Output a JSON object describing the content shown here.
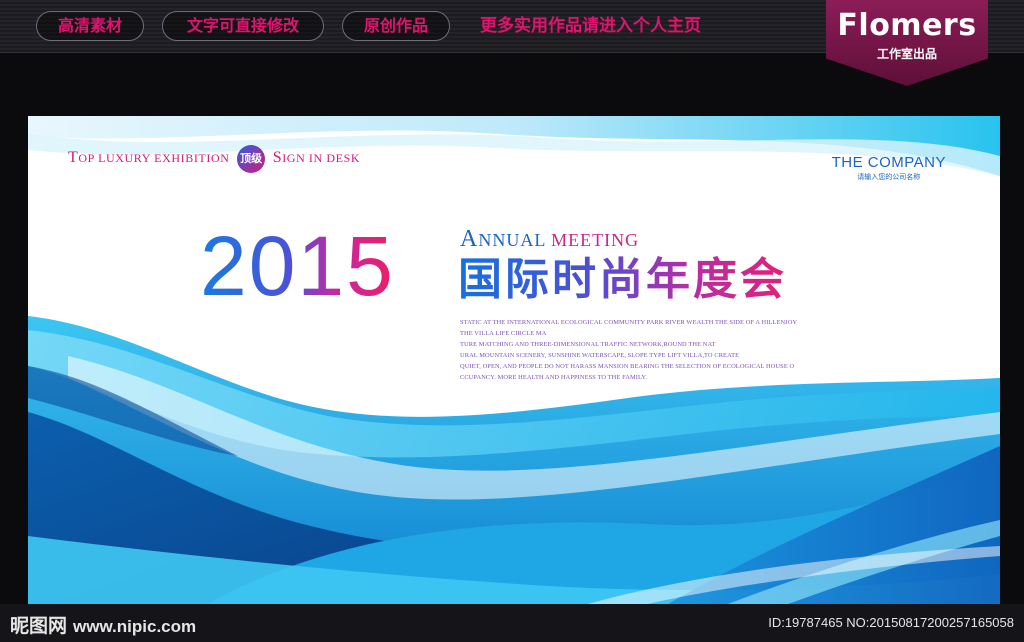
{
  "header": {
    "pills": [
      "高清素材",
      "文字可直接修改",
      "原创作品"
    ],
    "promo": "更多实用作品请进入个人主页",
    "brand": {
      "name": "Flomers",
      "subtitle": "工作室出品"
    }
  },
  "banner": {
    "tagline": {
      "w1_cap": "T",
      "w1_rest": "OP LUXURY EXHIBITION",
      "seal": "顶级",
      "w2_cap": "S",
      "w2_rest": "IGN IN DESK"
    },
    "company": {
      "name": "THE COMPANY",
      "hint": "请输入您的公司名称"
    },
    "year": "2015",
    "annual": {
      "w1_cap": "A",
      "w1_rest": "NNUAL",
      "w2": "MEETING"
    },
    "title_cn": "国际时尚年度会",
    "description": [
      "STATIC AT THE INTERNATIONAL ECOLOGICAL COMMUNITY PARK RIVER WEALTH THE SIDE OF A HILLENJOY",
      "THE VILLA LIFE CIRCLE MA",
      "TURE MATCHING AND THREE-DIMENSIONAL TRAFFIC NETWORK,ROUND THE NAT",
      "URAL MOUNTAIN SCENERY, SUNSHINE WATERSCAPE, SLOPE TYPE LIFT VILLA,TO CREATE",
      "QUIET, OPEN, AND PEOPLE DO NOT HARASS MANSION BEARING THE SELECTION OF ECOLOGICAL HOUSE O",
      "CCUPANCY. MORE HEALTH AND HAPPINESS TO THE FAMILY."
    ]
  },
  "footer": {
    "site_cn": "昵图网",
    "site_url": "www.nipic.com",
    "image_id": "ID:19787465 NO:20150817200257165058"
  },
  "colors": {
    "accent_pink": "#e0136f",
    "accent_blue": "#1b63c7",
    "brand_tag": "#8c1d57",
    "wave_blue": "#1ea7e6"
  }
}
